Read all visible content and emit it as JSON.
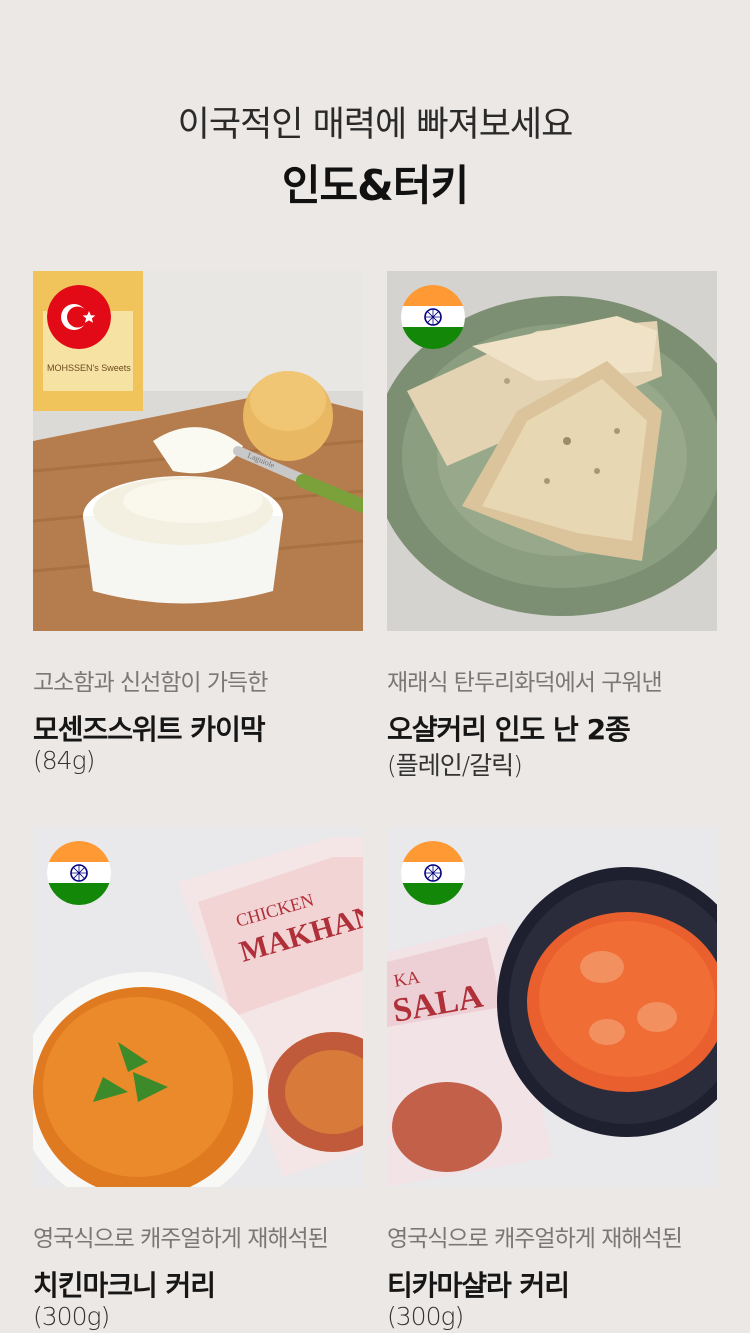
{
  "header": {
    "subtitle": "이국적인 매력에 빠져보세요",
    "title": "인도&터키"
  },
  "products": [
    {
      "description": "고소함과 신선함이 가득한",
      "name": "모센즈스위트 카이막",
      "weight": "(84g)",
      "flag_icon": "turkey-flag-icon",
      "package_text": "MOHSSEN's Sweets",
      "knife_text": "Laguiole"
    },
    {
      "description": "재래식 탄두리화덕에서 구워낸",
      "name": "오샬커리 인도 난 2종",
      "weight": "(플레인/갈릭)",
      "flag_icon": "india-flag-icon"
    },
    {
      "description": "영국식으로 캐주얼하게 재해석된",
      "name": "치킨마크니 커리",
      "weight": "(300g)",
      "flag_icon": "india-flag-icon",
      "package_text_1": "CHICKEN",
      "package_text_2": "MAKHANI"
    },
    {
      "description": "영국식으로 캐주얼하게 재해석된",
      "name": "티카마샬라 커리",
      "weight": "(300g)",
      "flag_icon": "india-flag-icon",
      "package_text_1": "KA",
      "package_text_2": "SALA"
    }
  ],
  "colors": {
    "background": "#ece8e5",
    "turkey_red": "#e30a17",
    "india_saffron": "#ff9933",
    "india_green": "#138808",
    "chakra_blue": "#000080"
  }
}
